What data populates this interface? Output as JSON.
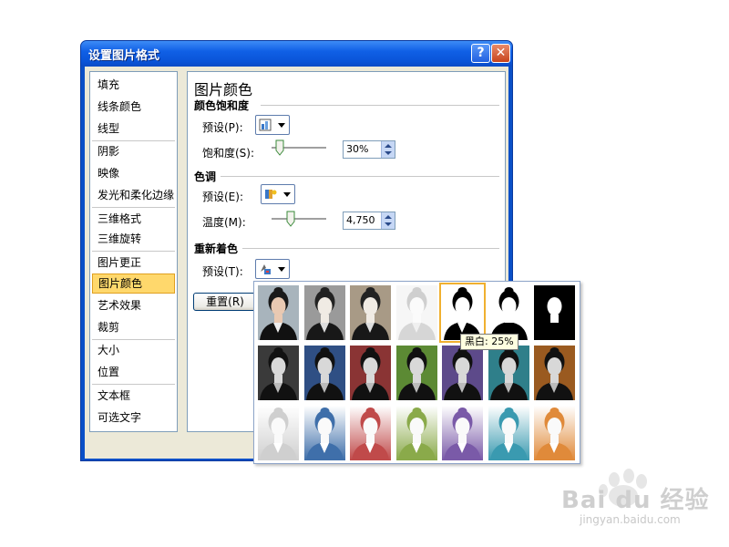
{
  "window": {
    "title": "设置图片格式",
    "help_glyph": "?",
    "close_glyph": "✕"
  },
  "nav": {
    "items": [
      {
        "label": "填充",
        "selected": false
      },
      {
        "label": "线条颜色",
        "selected": false
      },
      {
        "label": "线型",
        "selected": false
      },
      {
        "label": "阴影",
        "selected": false
      },
      {
        "label": "映像",
        "selected": false
      },
      {
        "label": "发光和柔化边缘",
        "selected": false
      },
      {
        "label": "三维格式",
        "selected": false
      },
      {
        "label": "三维旋转",
        "selected": false
      },
      {
        "label": "图片更正",
        "selected": false
      },
      {
        "label": "图片颜色",
        "selected": true
      },
      {
        "label": "艺术效果",
        "selected": false
      },
      {
        "label": "裁剪",
        "selected": false
      },
      {
        "label": "大小",
        "selected": false
      },
      {
        "label": "位置",
        "selected": false
      },
      {
        "label": "文本框",
        "selected": false
      },
      {
        "label": "可选文字",
        "selected": false
      }
    ]
  },
  "panel": {
    "title": "图片颜色",
    "saturation": {
      "heading": "颜色饱和度",
      "preset_label": "预设(P):",
      "amount_label": "饱和度(S):",
      "amount_value": "30%",
      "slider_fraction": 0.15
    },
    "tone": {
      "heading": "色调",
      "preset_label": "预设(E):",
      "temp_label": "温度(M):",
      "temp_value": "4,750",
      "slider_fraction": 0.35
    },
    "recolor": {
      "heading": "重新着色",
      "preset_label": "预设(T):"
    },
    "reset_label": "重置(R)"
  },
  "gallery": {
    "rows": [
      [
        {
          "name": "no-recolor",
          "tint": "#ffffff",
          "mode": "color"
        },
        {
          "name": "grayscale",
          "tint": "#9a9a9a",
          "mode": "tint"
        },
        {
          "name": "sepia",
          "tint": "#a89a86",
          "mode": "tint"
        },
        {
          "name": "washout",
          "tint": "#e8e8e8",
          "mode": "washout"
        },
        {
          "name": "black-white-25",
          "tint": "#000000",
          "mode": "bw1"
        },
        {
          "name": "black-white-50",
          "tint": "#000000",
          "mode": "bw2"
        },
        {
          "name": "black-white-75",
          "tint": "#000000",
          "mode": "bw3"
        }
      ],
      [
        {
          "name": "dark-gray",
          "tint": "#3a3a3a",
          "mode": "dark"
        },
        {
          "name": "dark-blue",
          "tint": "#2f4f84",
          "mode": "dark"
        },
        {
          "name": "dark-red",
          "tint": "#8a3434",
          "mode": "dark"
        },
        {
          "name": "dark-green",
          "tint": "#5c8a34",
          "mode": "dark"
        },
        {
          "name": "dark-purple",
          "tint": "#5d4a8a",
          "mode": "dark"
        },
        {
          "name": "dark-teal",
          "tint": "#2f7f8a",
          "mode": "dark"
        },
        {
          "name": "dark-orange",
          "tint": "#9a5a20",
          "mode": "dark"
        }
      ],
      [
        {
          "name": "light-gray",
          "tint": "#cfcfcf",
          "mode": "light"
        },
        {
          "name": "light-blue",
          "tint": "#3f6faa",
          "mode": "light"
        },
        {
          "name": "light-red",
          "tint": "#c04a4a",
          "mode": "light"
        },
        {
          "name": "light-green",
          "tint": "#8aaa4a",
          "mode": "light"
        },
        {
          "name": "light-purple",
          "tint": "#7a5aa8",
          "mode": "light"
        },
        {
          "name": "light-teal",
          "tint": "#3a9ab0",
          "mode": "light"
        },
        {
          "name": "light-orange",
          "tint": "#e08a3a",
          "mode": "light"
        }
      ]
    ],
    "hovered": "black-white-25",
    "tooltip": "黑白: 25%"
  },
  "watermark": {
    "brand": "Bai du 经验",
    "site": "jingyan.baidu.com"
  }
}
